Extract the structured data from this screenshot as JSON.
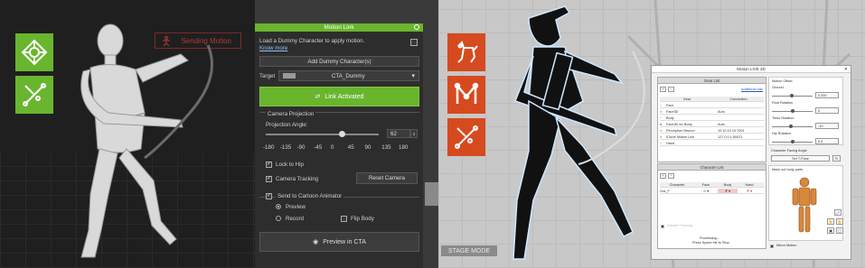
{
  "left": {
    "sending_label": "Sending Motion"
  },
  "panel": {
    "title": "Motion Link",
    "intro": "Load a Dummy Character to apply motion.",
    "know_more": "Know more",
    "add_dummy": "Add Dummy Character(s)",
    "target_label": "Target",
    "target_value": "CTA_Dummy",
    "link_activated": "Link Activated",
    "camera_projection": "Camera Projection",
    "projection_angle_label": "Projection Angle:",
    "projection_angle_value": "62",
    "angle_ticks": [
      "-180",
      "-135",
      "-90",
      "-45",
      "0",
      "45",
      "90",
      "135",
      "180"
    ],
    "angle_slider_value": 62,
    "lock_to_hip": "Lock to Hip",
    "camera_tracking": "Camera Tracking",
    "reset_camera": "Reset Camera",
    "send_to_ca": "Send to Cartoon Animator",
    "preview": "Preview",
    "record": "Record",
    "flip_body": "Flip Body",
    "preview_in_cta": "Preview in CTA"
  },
  "right": {
    "stage_mode": "STAGE MODE"
  },
  "motion_link_window": {
    "title": "Motion LIVE 2D",
    "gear_list_title": "Gear List",
    "additional_info": "Additional Info",
    "gear_headers": [
      "Gear",
      "Connection"
    ],
    "gear_rows": [
      {
        "name": "Face",
        "conn": ""
      },
      {
        "name": "Face3D",
        "conn": "Auto"
      },
      {
        "name": "Body",
        "conn": ""
      },
      {
        "name": "Face3D for Body",
        "conn": "Auto"
      },
      {
        "name": "Perception Neuron",
        "conn": "10.10.10.10:7001"
      },
      {
        "name": "iClone Motion Link",
        "conn": "127.0.0.1:50021"
      },
      {
        "name": "Hand",
        "conn": ""
      }
    ],
    "character_list_title": "Character List",
    "char_headers": [
      "Character",
      "Face",
      "Body",
      "Hand"
    ],
    "char_name": "Gra_F",
    "disable_tracking": "Disable Tracking",
    "processing": "Processing...",
    "press_space": "Press Space ele to Stop",
    "motion_offset": "Motion Offset",
    "ground": "Ground",
    "ground_value": "0.200",
    "root_rotation": "Root Rotation",
    "root_value": "0",
    "torso_rotation": "Torso Rotation",
    "torso_value": "-10",
    "hip_rotation": "Hip Rotation",
    "hip_value": "0.0",
    "facing_angle": "Character Facing Angle",
    "set_t_pose": "Set T-Pose",
    "mask_label": "Mask out body parts",
    "mirror_motion": "Mirror Motion"
  },
  "colors": {
    "green": "#6ab52e",
    "red": "#d64a1f"
  }
}
